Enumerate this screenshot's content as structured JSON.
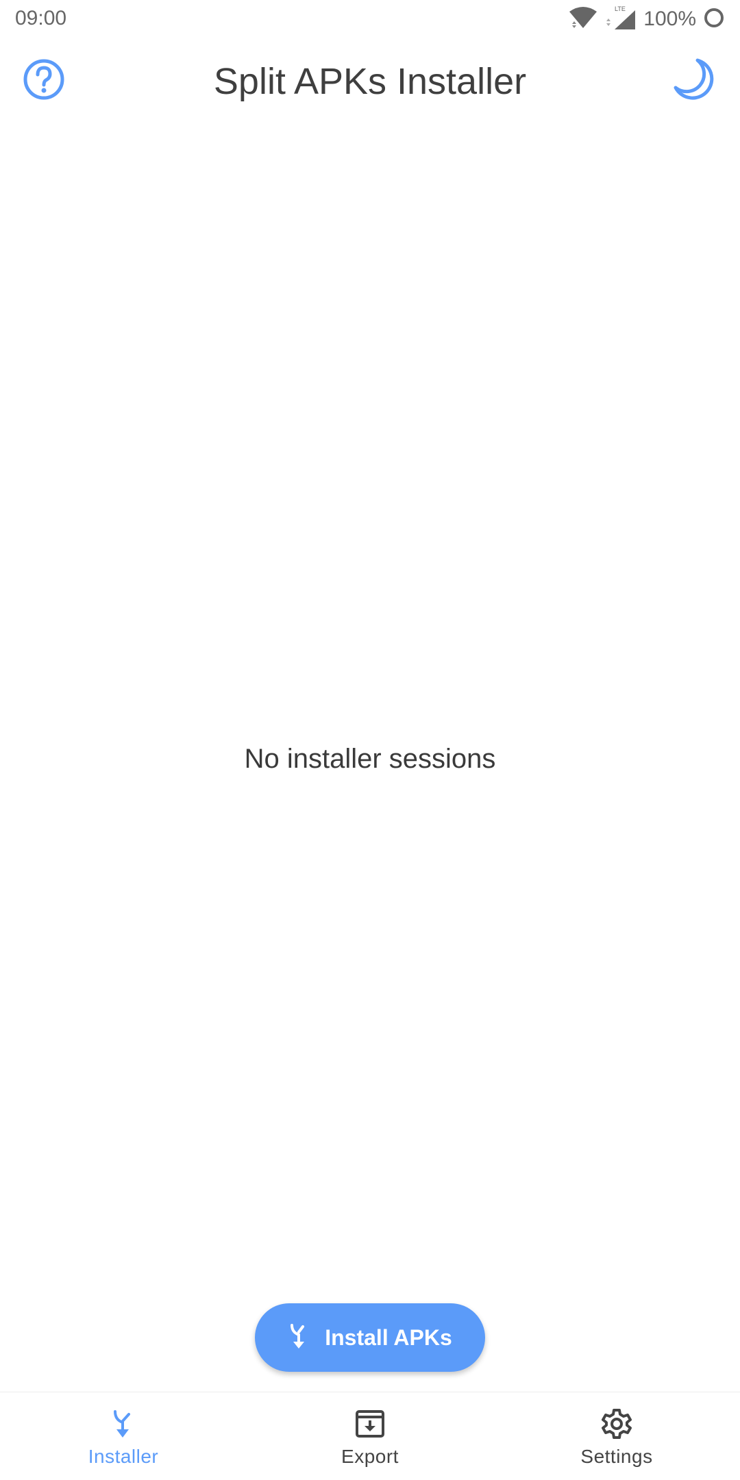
{
  "status_bar": {
    "time": "09:00",
    "battery": "100%",
    "icons": [
      "wifi-icon",
      "lte-signal-icon",
      "battery-icon"
    ]
  },
  "app_bar": {
    "title": "Split APKs Installer",
    "left_icon": "help-circle-icon",
    "right_icon": "moon-icon"
  },
  "main": {
    "empty_message": "No installer sessions"
  },
  "fab": {
    "label": "Install APKs",
    "icon": "merge-icon"
  },
  "bottom_nav": {
    "items": [
      {
        "label": "Installer",
        "icon": "merge-icon",
        "active": true
      },
      {
        "label": "Export",
        "icon": "archive-download-icon",
        "active": false
      },
      {
        "label": "Settings",
        "icon": "gear-icon",
        "active": false
      }
    ]
  },
  "colors": {
    "accent": "#5b9bf9",
    "text": "#3c3c3c",
    "inactive_icon": "#444444"
  }
}
